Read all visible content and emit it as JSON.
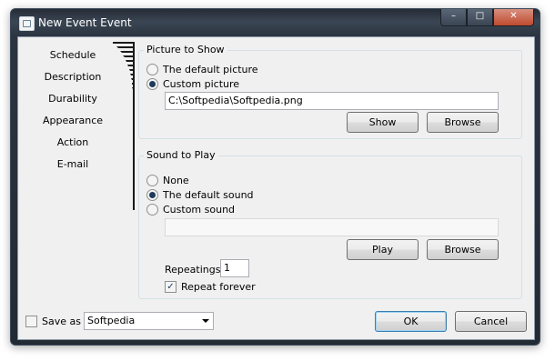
{
  "window": {
    "title": "New Event Event",
    "caption_min": "–",
    "caption_max": "□",
    "caption_close": "✕"
  },
  "nav": {
    "items": [
      "Schedule",
      "Description",
      "Durability",
      "Appearance",
      "Action",
      "E-mail"
    ]
  },
  "picture_group": {
    "title": "Picture to Show",
    "options": [
      "The default picture",
      "Custom picture"
    ],
    "selected_index": 1,
    "path_value": "C:\\Softpedia\\Softpedia.png",
    "show_label": "Show",
    "browse_label": "Browse"
  },
  "sound_group": {
    "title": "Sound to Play",
    "options": [
      "None",
      "The default sound",
      "Custom sound"
    ],
    "selected_index": 1,
    "path_value": "",
    "play_label": "Play",
    "browse_label": "Browse",
    "repeatings_label": "Repeatings",
    "repeatings_value": "1",
    "repeat_forever_label": "Repeat forever",
    "repeat_forever_checked": true
  },
  "footer": {
    "save_as_label": "Save as",
    "save_as_checked": false,
    "save_as_value": "Softpedia",
    "ok_label": "OK",
    "cancel_label": "Cancel"
  }
}
